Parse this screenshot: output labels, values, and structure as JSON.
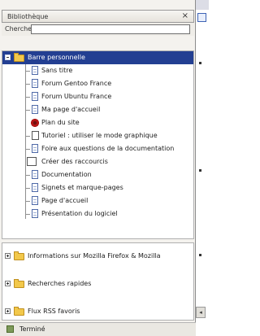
{
  "panel": {
    "title": "Bibliothèque",
    "close_glyph": "×"
  },
  "search": {
    "label": "Chercher :",
    "value": ""
  },
  "tree": {
    "root_label": "Barre personnelle",
    "items": [
      {
        "label": "Sans titre",
        "icon": "page-icon"
      },
      {
        "label": "Forum Gentoo France",
        "icon": "page-icon"
      },
      {
        "label": "Forum Ubuntu France",
        "icon": "page-icon"
      },
      {
        "label": "Ma page d'accueil",
        "icon": "page-icon"
      },
      {
        "label": "Plan du site",
        "icon": "flower-icon"
      },
      {
        "label": "Tutoriel : utiliser le mode graphique",
        "icon": "doc-icon"
      },
      {
        "label": "Foire aux questions de la documentation",
        "icon": "page-icon"
      },
      {
        "label": "Créer des raccourcis",
        "icon": "doc-icon"
      },
      {
        "label": "Documentation",
        "icon": "page-icon"
      },
      {
        "label": "Signets et marque-pages",
        "icon": "page-icon"
      },
      {
        "label": "Page d'accueil",
        "icon": "page-icon"
      },
      {
        "label": "Présentation du logiciel",
        "icon": "page-icon"
      }
    ]
  },
  "bottom_folders": [
    {
      "label": "Informations sur Mozilla Firefox & Mozilla"
    },
    {
      "label": "Recherches rapides"
    },
    {
      "label": "Flux RSS favoris"
    }
  ],
  "status": {
    "text": "Terminé"
  },
  "colors": {
    "selection": "#233f92",
    "folder": "#f2c84b"
  }
}
